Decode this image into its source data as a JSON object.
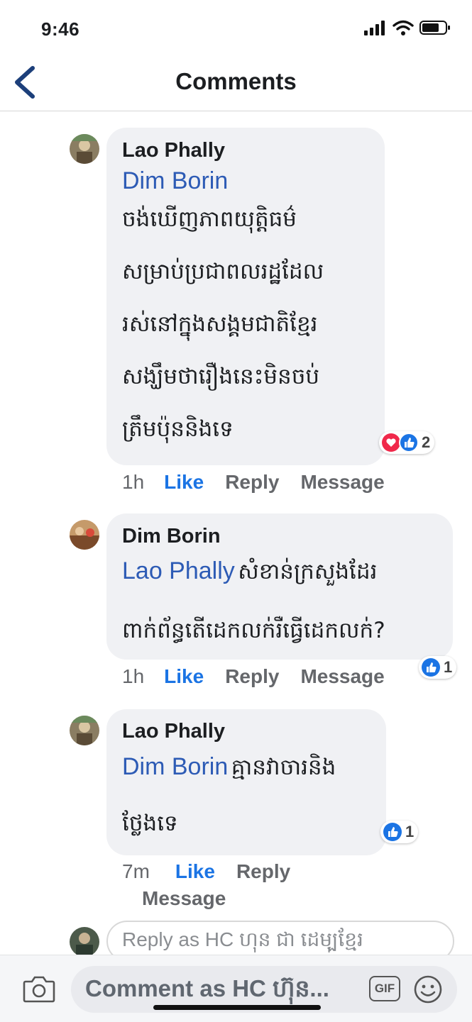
{
  "status_bar": {
    "time": "9:46"
  },
  "header": {
    "title": "Comments"
  },
  "comments": [
    {
      "author": "Lao Phally",
      "mention": "Dim Borin",
      "lines": [
        "ចង់ឃើញភាពយុត្តិធម៌",
        "សម្រាប់ប្រជាពលរដ្ឋដែល",
        "រស់នៅក្នុងសង្គមជាតិខ្មែរ",
        "សង្ឃឹមថារឿងនេះមិនចប់",
        "ត្រឹមប៉ុននិងទេ"
      ],
      "reaction_count": "2",
      "time": "1h",
      "like_label": "Like",
      "reply_label": "Reply",
      "message_label": "Message"
    },
    {
      "author": "Dim Borin",
      "mention": "Lao Phally",
      "first_text": "សំខាន់ក្រសួងដែរ",
      "lines": [
        "ពាក់ព័ន្ធតើដេកលក់រឺធ្វើដេកលក់?"
      ],
      "reaction_count": "1",
      "time": "1h",
      "like_label": "Like",
      "reply_label": "Reply",
      "message_label": "Message"
    },
    {
      "author": "Lao Phally",
      "mention": "Dim Borin",
      "first_text": "គ្មានវាចារនិង",
      "lines": [
        "ថ្លែងទេ"
      ],
      "reaction_count": "1",
      "time": "7m",
      "like_label": "Like",
      "reply_label": "Reply",
      "message_label": "Message"
    }
  ],
  "reply_box": {
    "placeholder": "Reply as HC ហុន ជា ដេមុ្បខ្មែរ"
  },
  "composer": {
    "placeholder": "Comment as HC ហ៊ុន...",
    "gif_label": "GIF"
  },
  "colors": {
    "link_blue": "#2d5bb5",
    "like_blue": "#1b74e4",
    "bubble_bg": "#f0f1f4"
  }
}
